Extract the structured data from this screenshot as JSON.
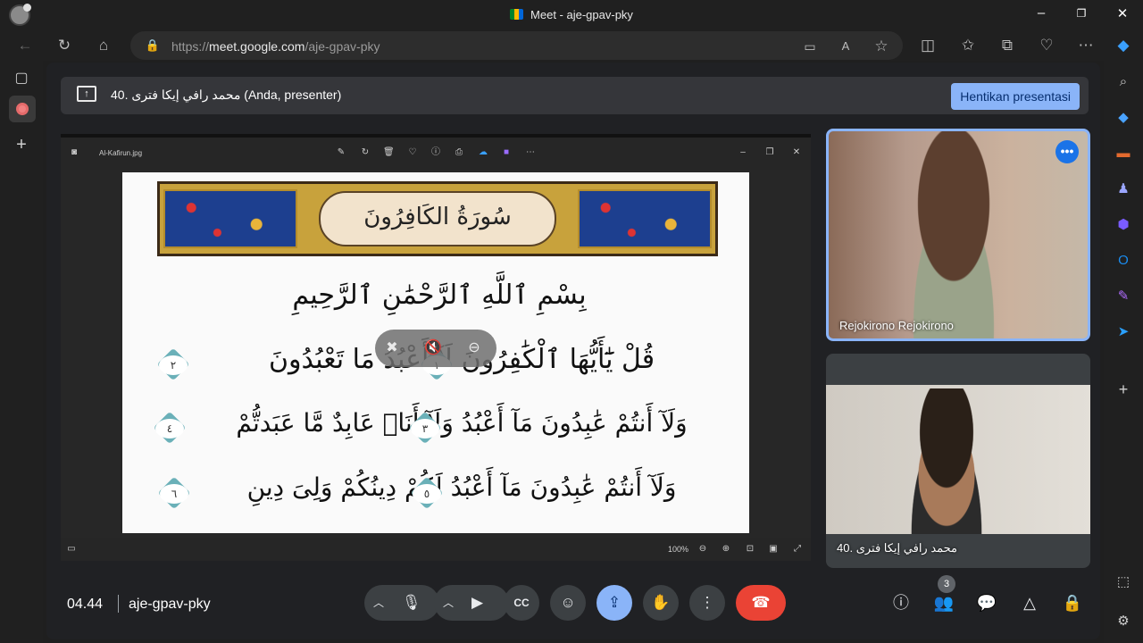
{
  "browser": {
    "window_title": "Meet - aje-gpav-pky",
    "url_scheme": "https://",
    "url_host": "meet.google.com",
    "url_path": "/aje-gpav-pky",
    "window_controls": {
      "minimize": "–",
      "restore": "❐",
      "close": "✕"
    }
  },
  "banner": {
    "text": "40. محمد رافي إيكا فترى (Anda, presenter)",
    "stop_button": "Hentikan presentasi"
  },
  "viewer": {
    "file_name": "Al-Kafirun.jpg",
    "zoom": "100%",
    "toolbar_icons": [
      "edit-icon",
      "rotate-icon",
      "delete-icon",
      "favorite-icon",
      "info-icon",
      "print-icon",
      "onedrive-icon",
      "clipchamp-icon",
      "more-icon"
    ]
  },
  "surah": {
    "title": "سُورَةُ الكَافِرُونَ",
    "basmala": "بِسْمِ ٱللَّهِ ٱلرَّحْمَٰنِ ٱلرَّحِيمِ",
    "line1": "قُلْ يَٰٓأَيُّهَا ٱلْكَٰفِرُونَ   لَآ أَعْبُدُ مَا تَعْبُدُونَ",
    "line2": "وَلَآ أَنتُمْ عَٰبِدُونَ مَآ أَعْبُدُ   وَلَآ أَنَا۠ عَابِدٌ مَّا عَبَدتُّمْ",
    "line3": "وَلَآ أَنتُمْ عَٰبِدُونَ مَآ أَعْبُدُ   لَكُمْ دِينُكُمْ وَلِىَ دِينِ",
    "verse_numbers": [
      "١",
      "٢",
      "٣",
      "٤",
      "٥",
      "٦"
    ]
  },
  "participants": [
    {
      "name": "Rejokirono Rejokirono"
    },
    {
      "name": "40. محمد رافي إيكا فترى"
    }
  ],
  "controls": {
    "time": "04.44",
    "meeting_code": "aje-gpav-pky",
    "people_count": "3"
  }
}
